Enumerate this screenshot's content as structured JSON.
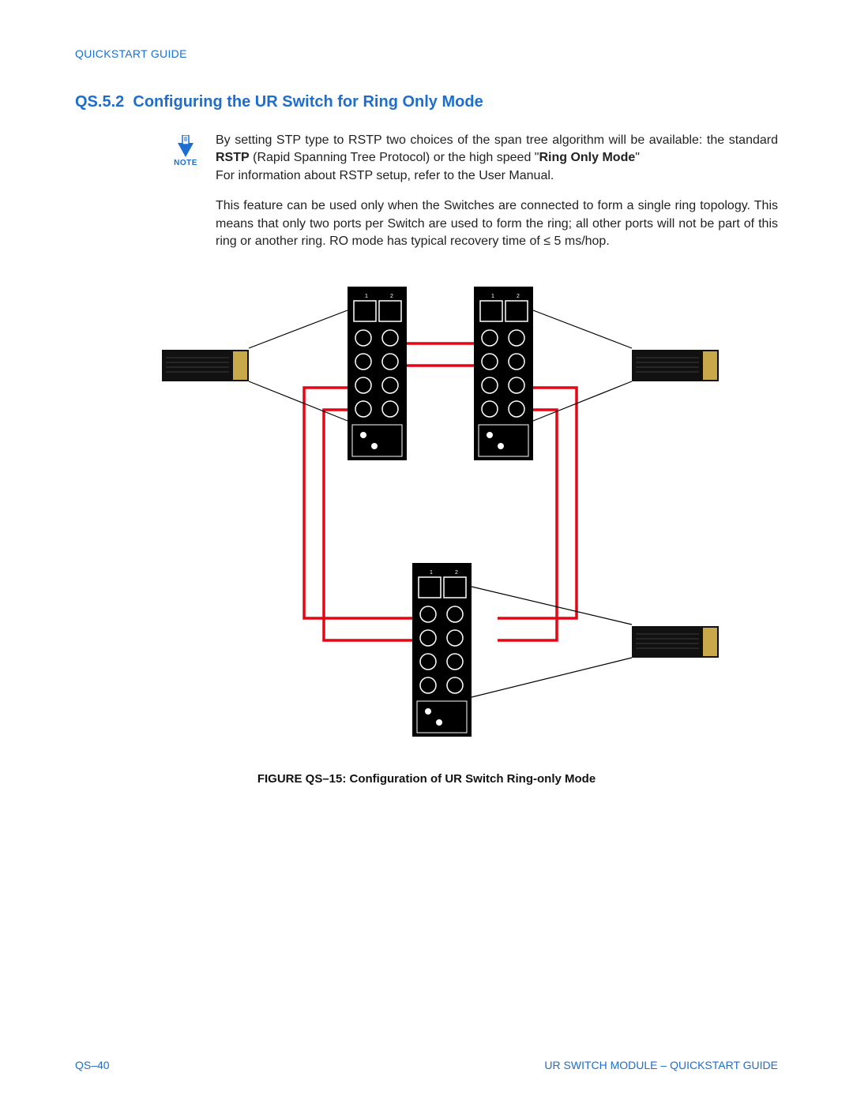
{
  "header": "QUICKSTART GUIDE",
  "section": {
    "number": "QS.5.2",
    "title": "Configuring the UR Switch for Ring Only Mode"
  },
  "note": {
    "label": "NOTE",
    "para1_a": "By setting STP type to RSTP two choices of the span tree algorithm will be available: the standard ",
    "para1_bold1": "RSTP",
    "para1_b": " (Rapid Spanning Tree Protocol) or the high speed \"",
    "para1_bold2": "Ring Only Mode",
    "para1_c": "\"",
    "para1_line2": "For information about RSTP setup, refer to the User Manual.",
    "para2": "This feature can be used only when the Switches are connected to form a single ring topology. This means that only two ports per Switch are used to form the ring; all other ports will not be part of this ring or another ring. RO mode has typical recovery time of ≤ 5 ms/hop."
  },
  "figure": {
    "caption": "FIGURE QS–15: Configuration of UR Switch Ring-only Mode"
  },
  "footer": {
    "left": "QS–40",
    "right": "UR SWITCH MODULE – QUICKSTART GUIDE"
  }
}
